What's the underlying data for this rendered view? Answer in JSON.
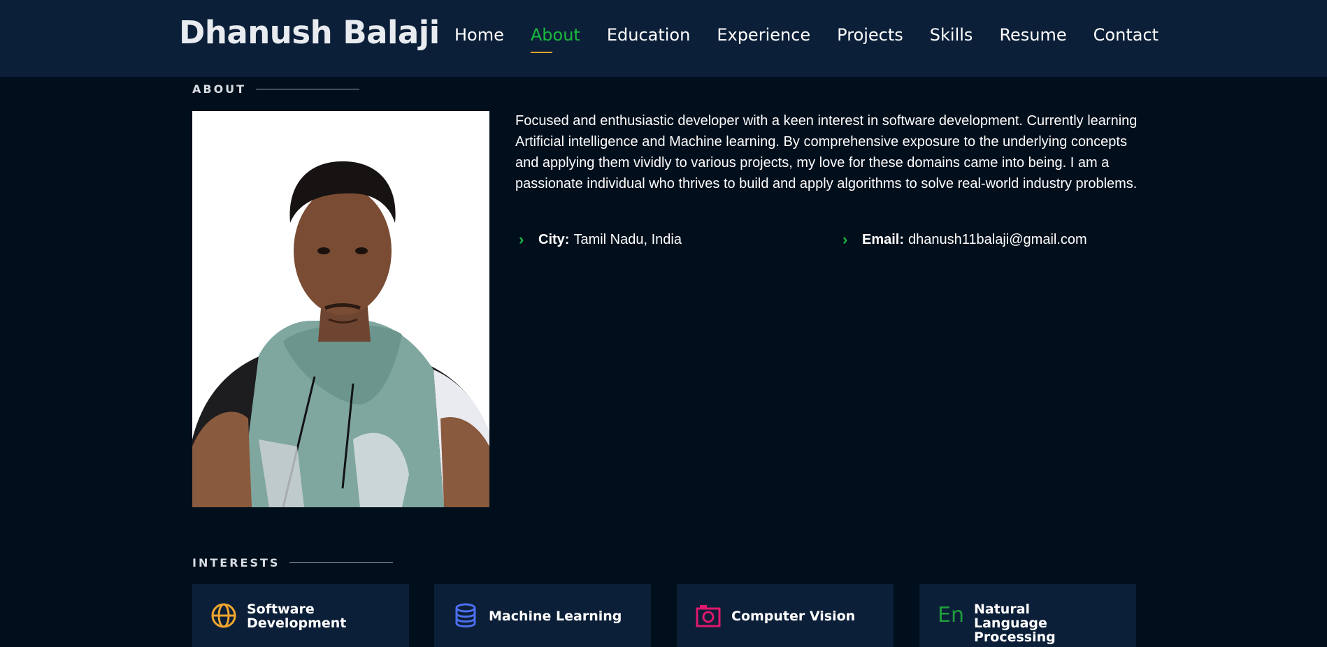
{
  "header": {
    "brand": "Dhanush Balaji",
    "nav": [
      {
        "label": "Home",
        "active": false
      },
      {
        "label": "About",
        "active": true
      },
      {
        "label": "Education",
        "active": false
      },
      {
        "label": "Experience",
        "active": false
      },
      {
        "label": "Projects",
        "active": false
      },
      {
        "label": "Skills",
        "active": false
      },
      {
        "label": "Resume",
        "active": false
      },
      {
        "label": "Contact",
        "active": false
      }
    ]
  },
  "about": {
    "section_title": "ABOUT",
    "description": "Focused and enthusiastic developer with a keen interest in software development. Currently learning Artificial intelligence and Machine learning. By comprehensive exposure to the underlying concepts and applying them vividly to various projects, my love for these domains came into being. I am a passionate individual who thrives to build and apply algorithms to solve real-world industry problems.",
    "city_label": "City:",
    "city_value": "Tamil Nadu, India",
    "email_label": "Email:",
    "email_value": "dhanush11balaji@gmail.com"
  },
  "interests": {
    "section_title": "INTERESTS",
    "items": [
      {
        "label": "Software Development",
        "icon": "globe-icon",
        "color": "#f0a72e"
      },
      {
        "label": "Machine Learning",
        "icon": "database-icon",
        "color": "#4c6ff0"
      },
      {
        "label": "Computer Vision",
        "icon": "camera-icon",
        "color": "#e0186e"
      },
      {
        "label": "Natural Language Processing",
        "icon": "language-en-icon",
        "color": "#1f9d3c"
      }
    ]
  },
  "colors": {
    "header_bg": "#0c1f38",
    "page_bg": "#010e1b",
    "accent_green": "#19b93e",
    "underline_gold": "#e0a328"
  }
}
